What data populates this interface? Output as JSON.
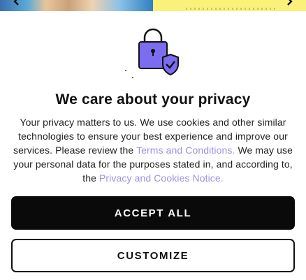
{
  "background": {
    "photo_colors": [
      "#3a6fb0",
      "#e7c59a",
      "#2f7fc1"
    ],
    "promo_color": "#fbf07a",
    "prev_arrow_icon": "chevron-left-icon",
    "next_arrow_icon": "chevron-right-icon"
  },
  "modal": {
    "icon": "lock-shield-icon",
    "title": "We care about your privacy",
    "body_part1": "Your privacy matters to us. We use cookies and other similar technologies to ensure your best experience and improve our services. Please review the ",
    "terms_link": "Terms and Conditions.",
    "body_part2": " We may use your personal data for the purposes stated in, and according to, the ",
    "privacy_link": "Privacy and Cookies Notice.",
    "link_color": "#9a93e0",
    "accept_label": "ACCEPT ALL",
    "customize_label": "CUSTOMIZE"
  },
  "colors": {
    "lock_purple": "#7b6cf0",
    "accept_bg": "#0a0a0a"
  }
}
